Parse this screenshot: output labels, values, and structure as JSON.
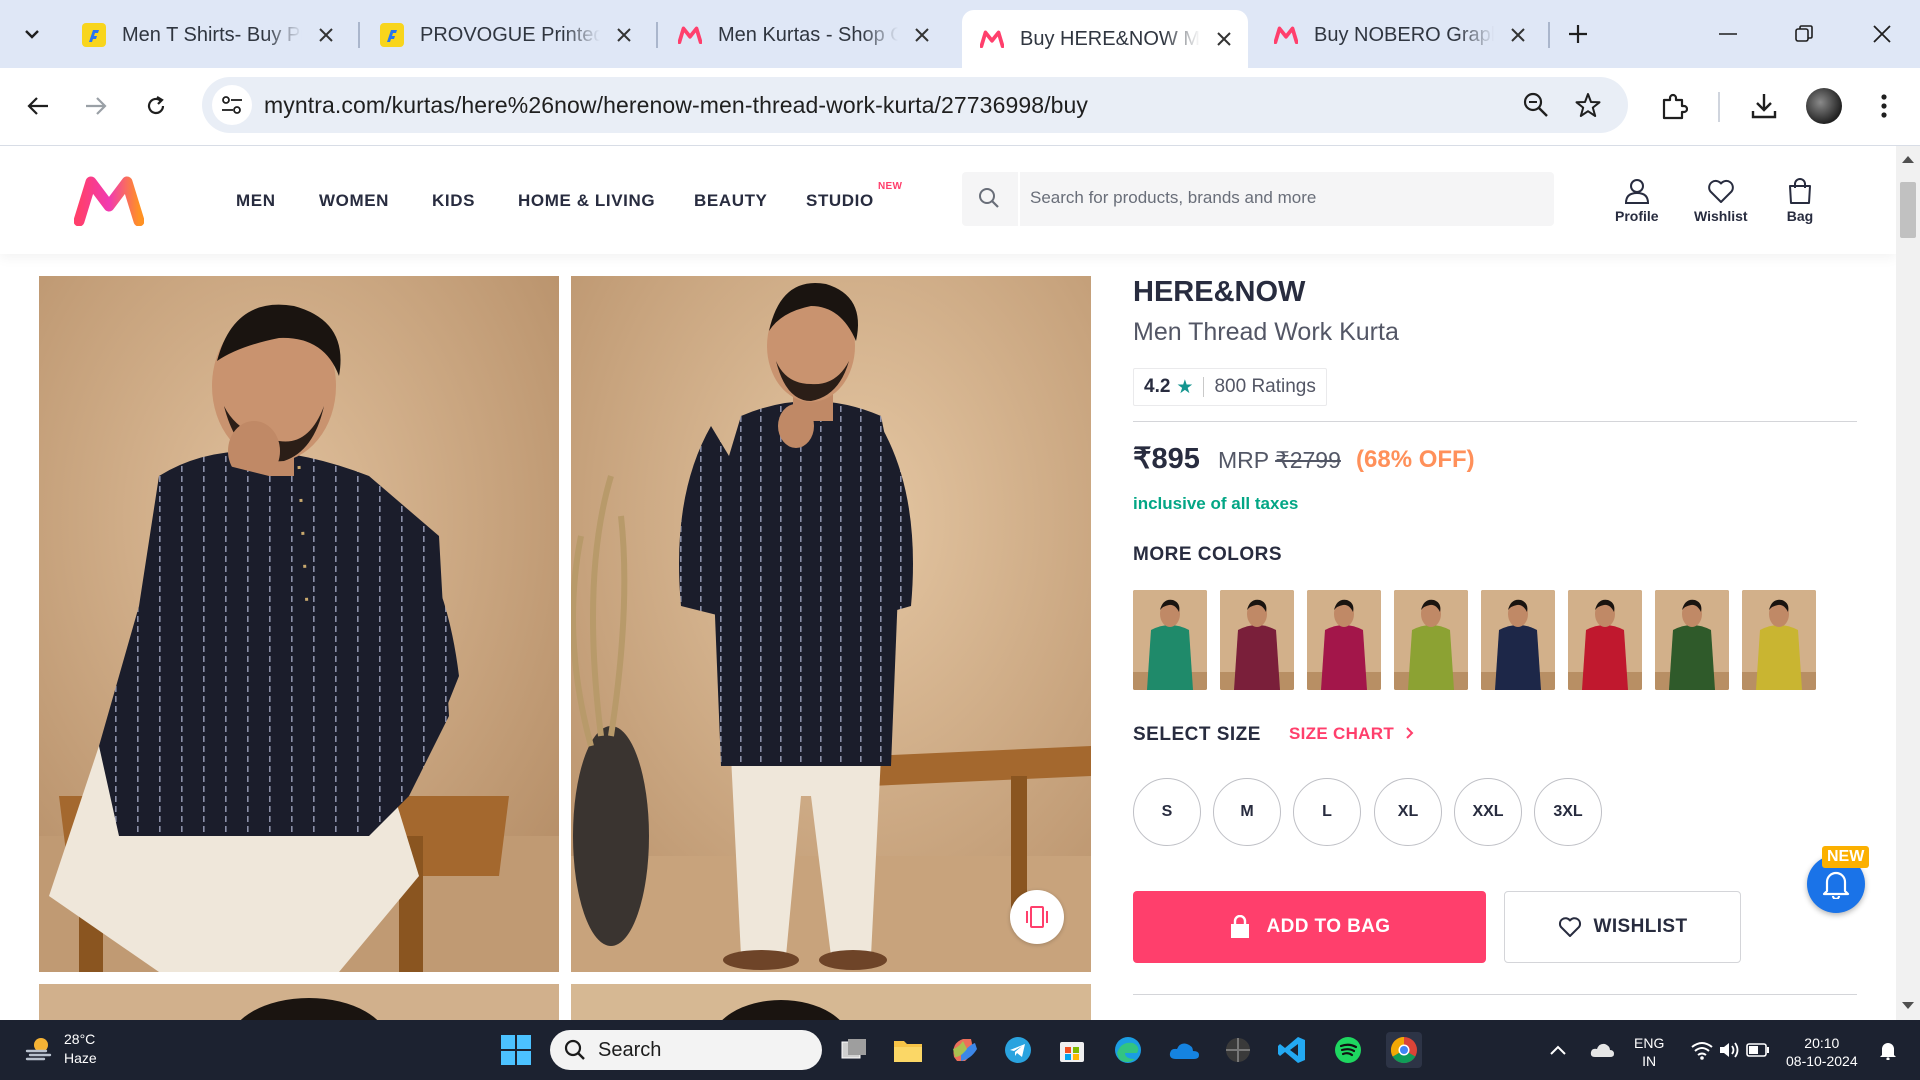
{
  "browser": {
    "tabs": [
      {
        "title": "Men T Shirts- Buy Printed",
        "favicon": "flipkart-icon",
        "active": false
      },
      {
        "title": "PROVOGUE Printed Men",
        "favicon": "flipkart-icon",
        "active": false
      },
      {
        "title": "Men Kurtas - Shop Online",
        "favicon": "myntra-icon",
        "active": false
      },
      {
        "title": "Buy HERE&NOW Men",
        "favicon": "myntra-icon",
        "active": true
      },
      {
        "title": "Buy NOBERO Graphic",
        "favicon": "myntra-icon",
        "active": false
      }
    ],
    "url": "myntra.com/kurtas/here%26now/herenow-men-thread-work-kurta/27736998/buy"
  },
  "header": {
    "nav": [
      "MEN",
      "WOMEN",
      "KIDS",
      "HOME & LIVING",
      "BEAUTY",
      "STUDIO"
    ],
    "studio_badge": "NEW",
    "search_placeholder": "Search for products, brands and more",
    "profile": "Profile",
    "wishlist": "Wishlist",
    "bag": "Bag"
  },
  "product": {
    "brand": "HERE&NOW",
    "name": "Men Thread Work Kurta",
    "rating": "4.2",
    "rating_count": "800 Ratings",
    "price": "₹895",
    "mrp_label": "MRP",
    "mrp": "₹2799",
    "discount": "(68% OFF)",
    "taxes": "inclusive of all taxes",
    "more_colors_title": "MORE COLORS",
    "colors": [
      "#1f8a6a",
      "#7a1f3a",
      "#a3164a",
      "#8ca233",
      "#1d2748",
      "#c0182e",
      "#2f5a2a",
      "#c9b531"
    ],
    "select_size_title": "SELECT SIZE",
    "size_chart": "SIZE CHART",
    "sizes": [
      "S",
      "M",
      "L",
      "XL",
      "XXL",
      "3XL"
    ],
    "add_to_bag": "ADD TO BAG",
    "wishlist_btn": "WISHLIST"
  },
  "notification_badge": "NEW",
  "taskbar": {
    "temp": "28°C",
    "weather": "Haze",
    "search": "Search",
    "lang1": "ENG",
    "lang2": "IN",
    "time": "20:10",
    "date": "08-10-2024"
  }
}
